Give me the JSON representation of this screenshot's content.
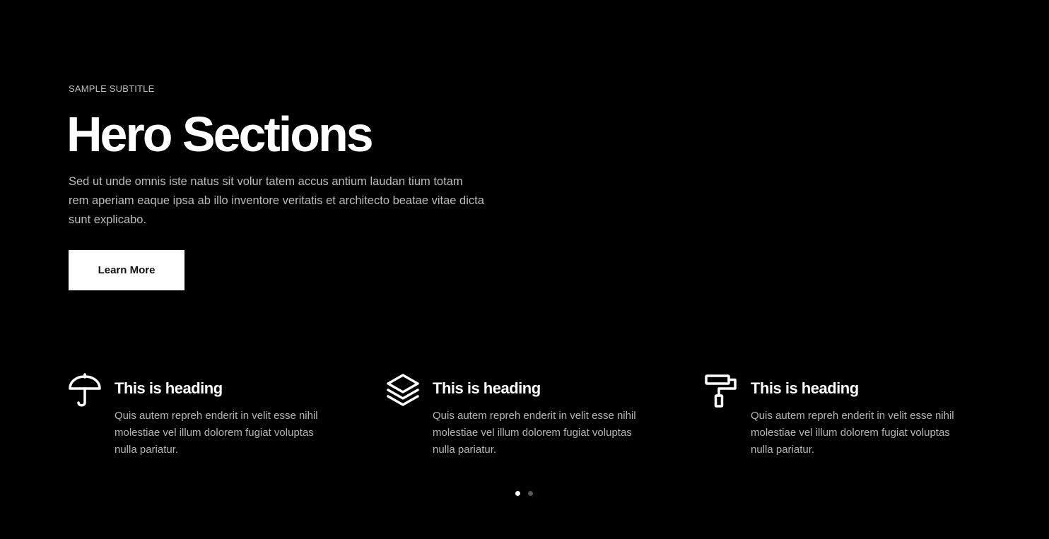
{
  "hero": {
    "subtitle": "SAMPLE SUBTITLE",
    "title": "Hero Sections",
    "description": "Sed ut unde omnis iste natus sit volur tatem accus antium laudan tium totam rem aperiam eaque ipsa ab illo inventore veritatis et architecto beatae vitae dicta sunt explicabo.",
    "button_label": "Learn More"
  },
  "features": [
    {
      "icon": "umbrella-icon",
      "heading": "This is heading",
      "text": "Quis autem repreh enderit in velit esse nihil molestiae vel illum dolorem fugiat voluptas nulla pariatur."
    },
    {
      "icon": "layers-icon",
      "heading": "This is heading",
      "text": "Quis autem repreh enderit in velit esse nihil molestiae vel illum dolorem fugiat voluptas nulla pariatur."
    },
    {
      "icon": "paint-roller-icon",
      "heading": "This is heading",
      "text": "Quis autem repreh enderit in velit esse nihil molestiae vel illum dolorem fugiat voluptas nulla pariatur."
    }
  ],
  "pagination": {
    "total": 2,
    "active": 1
  },
  "colors": {
    "background": "#000000",
    "text": "#ffffff",
    "muted_text": "#bcbcbc",
    "button_bg": "#ffffff",
    "button_text": "#111111",
    "dot_inactive": "#555555"
  }
}
